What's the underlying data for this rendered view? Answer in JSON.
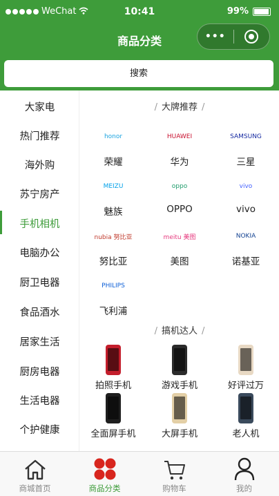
{
  "status": {
    "carrier": "WeChat",
    "time": "10:41",
    "battery": "99%"
  },
  "nav": {
    "title": "商品分类",
    "more": "•••"
  },
  "search": {
    "label": "搜索"
  },
  "sidebar": {
    "items": [
      {
        "label": "大家电"
      },
      {
        "label": "热门推荐"
      },
      {
        "label": "海外购"
      },
      {
        "label": "苏宁房产"
      },
      {
        "label": "手机相机"
      },
      {
        "label": "电脑办公"
      },
      {
        "label": "厨卫电器"
      },
      {
        "label": "食品酒水"
      },
      {
        "label": "居家生活"
      },
      {
        "label": "厨房电器"
      },
      {
        "label": "生活电器"
      },
      {
        "label": "个护健康"
      }
    ],
    "active_index": 4
  },
  "brands_section": {
    "title": "大牌推荐"
  },
  "brands": [
    {
      "name": "荣耀",
      "logo": "honor",
      "color": "#1aa3e0"
    },
    {
      "name": "华为",
      "logo": "HUAWEI",
      "color": "#c8102e"
    },
    {
      "name": "三星",
      "logo": "SAMSUNG",
      "color": "#1428a0"
    },
    {
      "name": "魅族",
      "logo": "MEIZU",
      "color": "#00a0e9"
    },
    {
      "name": "OPPO",
      "logo": "oppo",
      "color": "#1d9b6a"
    },
    {
      "name": "vivo",
      "logo": "vivo",
      "color": "#415fff"
    },
    {
      "name": "努比亚",
      "logo": "nubia 努比亚",
      "color": "#c0392b"
    },
    {
      "name": "美图",
      "logo": "meitu 美图",
      "color": "#e6397e"
    },
    {
      "name": "诺基亚",
      "logo": "NOKIA",
      "color": "#124191"
    },
    {
      "name": "飞利浦",
      "logo": "PHILIPS",
      "color": "#0b5ed7"
    }
  ],
  "experts_section": {
    "title": "搞机达人"
  },
  "experts": [
    {
      "name": "拍照手机",
      "color": "#c41e2c"
    },
    {
      "name": "游戏手机",
      "color": "#2b2b2b"
    },
    {
      "name": "好评过万",
      "color": "#e8d9c4"
    },
    {
      "name": "全面屏手机",
      "color": "#1f1f1f"
    },
    {
      "name": "大屏手机",
      "color": "#e3cfa6"
    },
    {
      "name": "老人机",
      "color": "#3a4a5c"
    }
  ],
  "tabbar": [
    {
      "label": "商城首页",
      "icon": "home-icon"
    },
    {
      "label": "商品分类",
      "icon": "category-icon"
    },
    {
      "label": "购物车",
      "icon": "cart-icon"
    },
    {
      "label": "我的",
      "icon": "user-icon"
    }
  ],
  "theme": {
    "accent": "#3e9c3a"
  }
}
